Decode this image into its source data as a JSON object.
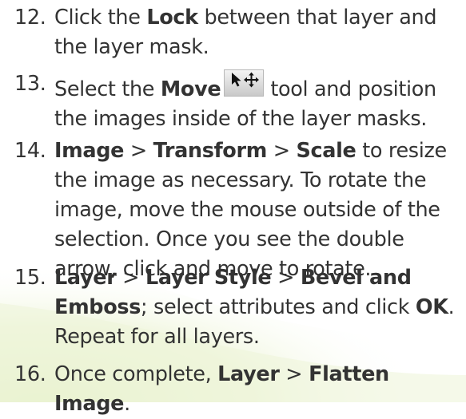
{
  "instructions": {
    "step12": {
      "number": "12.",
      "t1": "Click the ",
      "b1": "Lock",
      "t2": " between that layer and",
      "t3": "the layer mask."
    },
    "step13": {
      "number": "13.",
      "t1": "Select the ",
      "b1": "Move",
      "icon": "move-tool-icon",
      "t2": "tool and position",
      "t3": "the images inside of the layer masks."
    },
    "step14": {
      "number": "14.",
      "b1": "Image",
      "sep1": " > ",
      "b2": "Transform",
      "sep2": " > ",
      "b3": "Scale",
      "t1": " to resize",
      "t2": "the image as necessary. To rotate the",
      "t3": "image, move the mouse outside of the",
      "t4": "selection. Once you see the double",
      "t5": "arrow, click and move to rotate."
    },
    "step15": {
      "number": "15.",
      "b1": "Layer",
      "sep1": " > ",
      "b2": "Layer Style",
      "sep2": " > ",
      "b3": "Bevel and",
      "b4": "Emboss",
      "t1": "; select attributes and click ",
      "b5": "OK",
      "t2": ".",
      "t3": "Repeat for all layers."
    },
    "step16": {
      "number": "16.",
      "t1": "Once complete, ",
      "b1": "Layer",
      "sep1": " > ",
      "b2": "Flatten Image",
      "t2": "."
    }
  },
  "colors": {
    "text": "#333333",
    "background": "#ffffff",
    "swoosh": "#eef5d6"
  }
}
